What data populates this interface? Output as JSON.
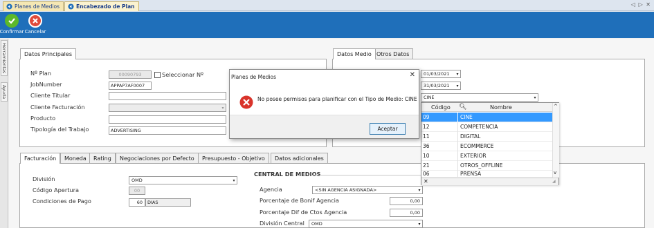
{
  "tabs": [
    {
      "label": "Planes de Medios"
    },
    {
      "label": "Encabezado de Plan"
    }
  ],
  "window_controls": "◁ ▷ ✕",
  "toolbar": {
    "confirm_label": "Confirmar",
    "cancel_label": "Cancelar"
  },
  "sidebar": {
    "items": [
      {
        "label": "Herramientas"
      },
      {
        "label": "Ayuda"
      }
    ]
  },
  "datos_principales": {
    "tab_label": "Datos Principales",
    "n_plan_label": "Nº Plan",
    "n_plan_value": "00090793",
    "seleccionar_label": "Seleccionar Nº",
    "jobnumber_label": "JobNumber",
    "jobnumber_value": "APPAP7AF0007",
    "cliente_titular_label": "Cliente Titular",
    "cliente_facturacion_label": "Cliente Facturación",
    "producto_label": "Producto",
    "tipologia_label": "Tipología del Trabajo",
    "tipologia_value": "ADVERTISING"
  },
  "datos_medio": {
    "tab_medio_label": "Datos Medio",
    "tab_otros_label": "Otros Datos",
    "fecha_desde": "01/03/2021",
    "fecha_hasta": "31/03/2021",
    "tipo_medio_value": "CINE"
  },
  "dropdown": {
    "col_codigo": "Código",
    "col_nombre": "Nombre",
    "rows": [
      {
        "code": "09",
        "name": "CINE"
      },
      {
        "code": "12",
        "name": "COMPETENCIA"
      },
      {
        "code": "11",
        "name": "DIGITAL"
      },
      {
        "code": "36",
        "name": "ECOMMERCE"
      },
      {
        "code": "10",
        "name": "EXTERIOR"
      },
      {
        "code": "21",
        "name": "OTROS_OFFLINE"
      },
      {
        "code": "06",
        "name": "PRENSA"
      }
    ],
    "clear_label": "✕"
  },
  "dialog": {
    "title": "Planes de Medios",
    "message": "No posee permisos para planificar con el Tipo de Medio: CINE",
    "ok_label": "Aceptar"
  },
  "bottom_tabs": [
    {
      "label": "Facturación"
    },
    {
      "label": "Moneda"
    },
    {
      "label": "Rating"
    },
    {
      "label": "Negociaciones por Defecto"
    },
    {
      "label": "Presupuesto - Objetivo"
    },
    {
      "label": "Datos adicionales"
    }
  ],
  "facturacion": {
    "division_label": "División",
    "division_value": "OMD",
    "codigo_apertura_label": "Código Apertura",
    "codigo_apertura_value": "00",
    "condiciones_label": "Condiciones de Pago",
    "condiciones_num": "60",
    "condiciones_unit": "DIAS"
  },
  "central": {
    "title": "CENTRAL DE MEDIOS",
    "agencia_label": "Agencia",
    "agencia_value": "<SIN AGENCIA ASIGNADA>",
    "bonif_label": "Porcentaje de Bonif Agencia",
    "bonif_value": "0,00",
    "dif_label": "Porcentaje Dif de Ctos Agencia",
    "dif_value": "0,00",
    "division_central_label": "División Central",
    "division_central_value": "OMD"
  },
  "colors": {
    "toolbar": "#1f6fba",
    "selection": "#3399ff",
    "confirm": "#5cb82a",
    "cancel": "#e04a3a",
    "error": "#d9342b"
  }
}
